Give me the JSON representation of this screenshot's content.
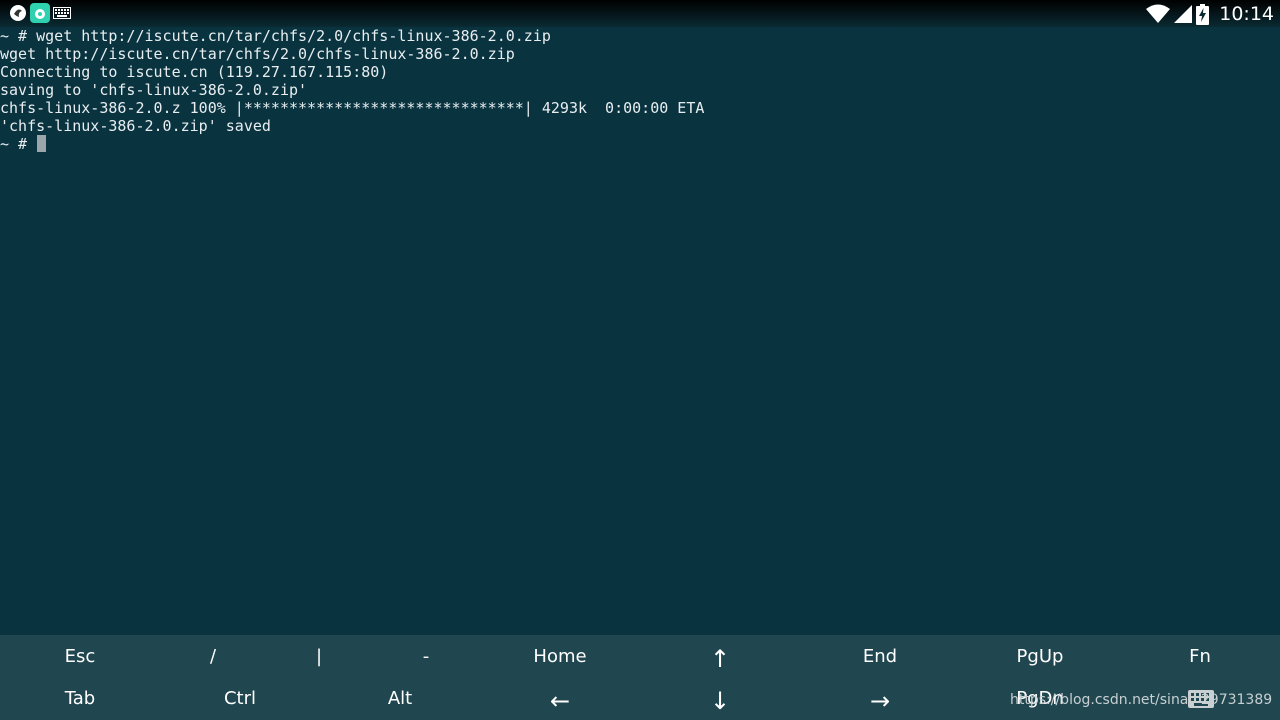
{
  "status_bar": {
    "time": "10:14",
    "icons": [
      "app-icon-1",
      "app-icon-2",
      "keyboard-notification-icon",
      "wifi-icon",
      "cell-signal-icon",
      "battery-charging-icon"
    ]
  },
  "terminal": {
    "lines": [
      "~ # wget http://iscute.cn/tar/chfs/2.0/chfs-linux-386-2.0.zip",
      "wget http://iscute.cn/tar/chfs/2.0/chfs-linux-386-2.0.zip",
      "Connecting to iscute.cn (119.27.167.115:80)",
      "saving to 'chfs-linux-386-2.0.zip'",
      "chfs-linux-386-2.0.z 100% |*******************************| 4293k  0:00:00 ETA",
      "'chfs-linux-386-2.0.zip' saved"
    ],
    "prompt": "~ # "
  },
  "extra_keys": {
    "row1": [
      "Esc",
      "/",
      "|",
      "-",
      "Home",
      "↑",
      "End",
      "PgUp",
      "Fn"
    ],
    "row2": [
      "Tab",
      "Ctrl",
      "Alt",
      "←",
      "↓",
      "→",
      "PgDn",
      "",
      ""
    ]
  },
  "watermark": "https://blog.csdn.net/sinat_29731389",
  "colors": {
    "terminal_bg": "#0a3340",
    "extra_keys_bg": "#20464f",
    "text": "#e8eef0"
  }
}
